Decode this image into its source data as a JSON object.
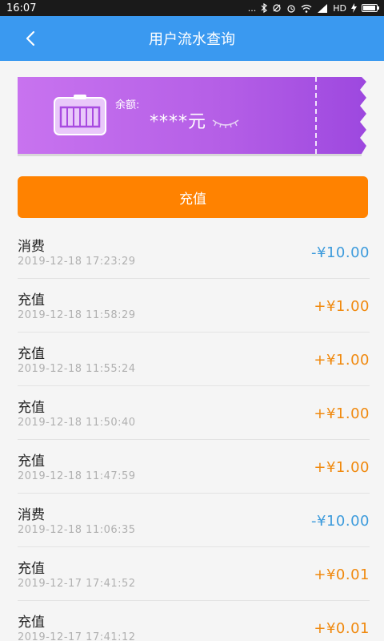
{
  "status_bar": {
    "time": "16:07",
    "dots": "...",
    "network": "HD",
    "icons": [
      "bluetooth-icon",
      "alarm-icon",
      "wifi-icon",
      "signal-icon",
      "charging-icon",
      "battery-icon"
    ]
  },
  "header": {
    "title": "用户流水查询",
    "back_icon": "chevron-left-icon",
    "background_color": "#3a99f0"
  },
  "balance_card": {
    "label": "余额:",
    "balance": "****元",
    "icon": "card-icon",
    "eye_icon": "eye-closed-icon",
    "gradient_colors": [
      "#c873ef",
      "#9d48df"
    ]
  },
  "recharge_button": {
    "label": "充值",
    "color": "#ff8200"
  },
  "transactions": [
    {
      "type": "消费",
      "datetime": "2019-12-18  17:23:29",
      "amount": "-¥10.00",
      "kind": "debit"
    },
    {
      "type": "充值",
      "datetime": "2019-12-18  11:58:29",
      "amount": "+¥1.00",
      "kind": "credit"
    },
    {
      "type": "充值",
      "datetime": "2019-12-18  11:55:24",
      "amount": "+¥1.00",
      "kind": "credit"
    },
    {
      "type": "充值",
      "datetime": "2019-12-18  11:50:40",
      "amount": "+¥1.00",
      "kind": "credit"
    },
    {
      "type": "充值",
      "datetime": "2019-12-18  11:47:59",
      "amount": "+¥1.00",
      "kind": "credit"
    },
    {
      "type": "消费",
      "datetime": "2019-12-18  11:06:35",
      "amount": "-¥10.00",
      "kind": "debit"
    },
    {
      "type": "充值",
      "datetime": "2019-12-17  17:41:52",
      "amount": "+¥0.01",
      "kind": "credit"
    },
    {
      "type": "充值",
      "datetime": "2019-12-17  17:41:12",
      "amount": "+¥0.01",
      "kind": "credit"
    }
  ],
  "colors": {
    "debit": "#3d9bdc",
    "credit": "#f0890e"
  }
}
